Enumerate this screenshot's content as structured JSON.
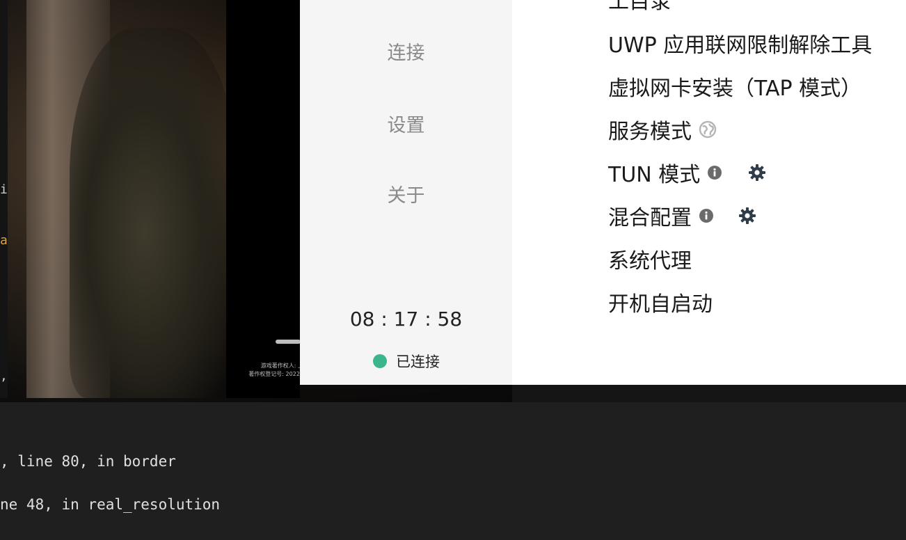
{
  "sidebar": {
    "nav": [
      "连接",
      "设置",
      "关于"
    ],
    "timer": "08 : 17 : 58",
    "status_text": "已连接",
    "status_color": "#3ab58c"
  },
  "settings": {
    "partial_top_item": "工目录",
    "items": [
      "UWP 应用联网限制解除工具",
      "虚拟网卡安装（TAP 模式）",
      "服务模式",
      "TUN 模式",
      "混合配置",
      "系统代理",
      "开机自启动"
    ],
    "icons": {
      "service_mode": "globe-icon",
      "tun_mode_info": "info-icon",
      "tun_mode_settings": "gear-icon",
      "mixed_info": "info-icon",
      "mixed_settings": "gear-icon"
    }
  },
  "background": {
    "caption_line_1": "游戏著作权人: 上",
    "caption_line_2": "著作权登记号: 2022S"
  },
  "terminal": {
    "lines": [
      ", line 80, in border",
      "ne 48, in real_resolution"
    ]
  },
  "left_edge": {
    "fragments": [
      "i",
      "a",
      ","
    ]
  }
}
